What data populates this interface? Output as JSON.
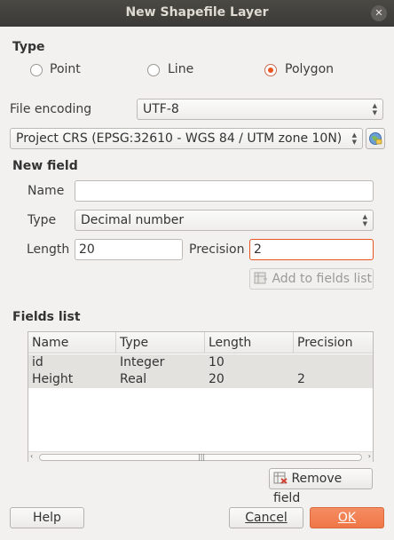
{
  "window": {
    "title": "New Shapefile Layer"
  },
  "type_section": {
    "heading": "Type",
    "options": [
      {
        "label": "Point",
        "checked": false
      },
      {
        "label": "Line",
        "checked": false
      },
      {
        "label": "Polygon",
        "checked": true
      }
    ]
  },
  "file_encoding": {
    "label": "File encoding",
    "value": "UTF-8"
  },
  "crs": {
    "value": "Project CRS (EPSG:32610 - WGS 84 / UTM zone 10N)"
  },
  "new_field": {
    "heading": "New field",
    "name_label": "Name",
    "name_value": "",
    "type_label": "Type",
    "type_value": "Decimal number",
    "length_label": "Length",
    "length_value": "20",
    "precision_label": "Precision",
    "precision_value": "2",
    "add_button": "Add to fields list"
  },
  "fields_list": {
    "heading": "Fields list",
    "columns": [
      "Name",
      "Type",
      "Length",
      "Precision"
    ],
    "rows": [
      [
        "id",
        "Integer",
        "10",
        ""
      ],
      [
        "Height",
        "Real",
        "20",
        "2"
      ]
    ],
    "remove_button": "Remove field"
  },
  "buttons": {
    "help": "Help",
    "cancel": "Cancel",
    "ok": "OK"
  },
  "colors": {
    "accent": "#e95420",
    "titlebar": "#3c3b37",
    "background": "#f2f1f0"
  }
}
